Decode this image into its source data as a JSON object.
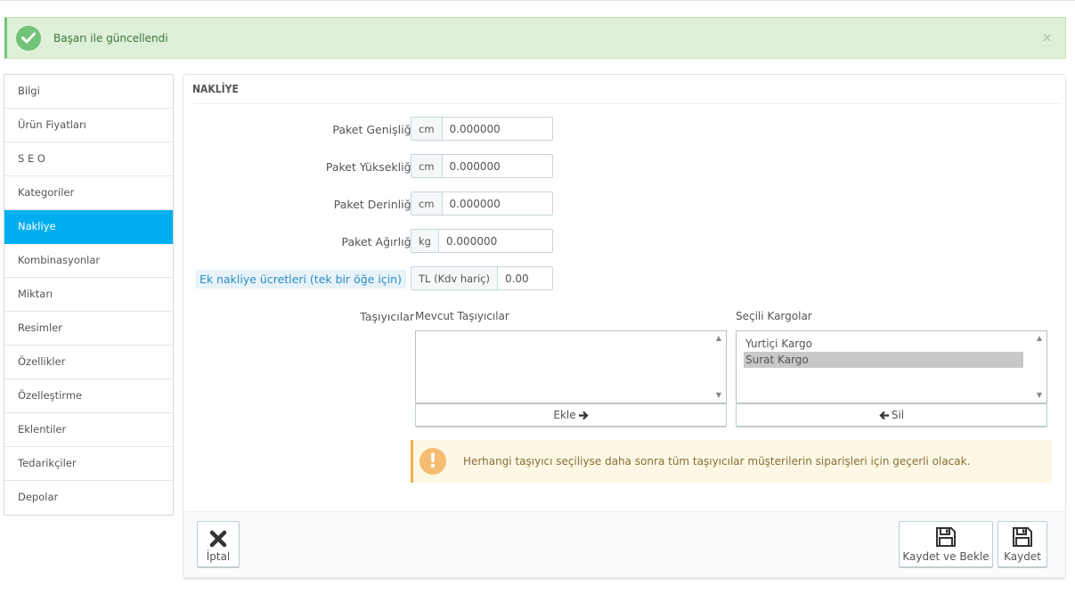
{
  "alert": {
    "message": "Başarı ile güncellendi",
    "close": "×"
  },
  "sidebar": {
    "items": [
      {
        "label": "Bilgi"
      },
      {
        "label": "Ürün Fiyatları"
      },
      {
        "label": "S E O"
      },
      {
        "label": "Kategoriler"
      },
      {
        "label": "Nakliye"
      },
      {
        "label": "Kombinasyonlar"
      },
      {
        "label": "Miktarı"
      },
      {
        "label": "Resimler"
      },
      {
        "label": "Özellikler"
      },
      {
        "label": "Özelleştirme"
      },
      {
        "label": "Eklentiler"
      },
      {
        "label": "Tedarikçiler"
      },
      {
        "label": "Depolar"
      }
    ],
    "active": "Nakliye"
  },
  "panel": {
    "title": "NAKLİYE"
  },
  "form": {
    "width": {
      "label": "Paket Genişliği",
      "unit": "cm",
      "value": "0.000000"
    },
    "height": {
      "label": "Paket Yüksekliği",
      "unit": "cm",
      "value": "0.000000"
    },
    "depth": {
      "label": "Paket Derinliği",
      "unit": "cm",
      "value": "0.000000"
    },
    "weight": {
      "label": "Paket Ağırlığı",
      "unit": "kg",
      "value": "0.000000"
    },
    "extra": {
      "label": "Ek nakliye ücretleri (tek bir öğe için)",
      "unit": "TL (Kdv hariç)",
      "value": "0.00"
    }
  },
  "carriers": {
    "label": "Taşıyıcılar",
    "available_title": "Mevcut Taşıyıcılar",
    "selected_title": "Seçili Kargolar",
    "available": [],
    "selected": [
      "Yurtiçi Kargo",
      "Surat Kargo"
    ],
    "add_label": "Ekle",
    "remove_label": "Sil"
  },
  "warning": {
    "message": "Herhangi taşıyıcı seçiliyse daha sonra tüm taşıyıcılar müşterilerin siparişleri için geçerli olacak."
  },
  "footer": {
    "cancel": "İptal",
    "save_stay": "Kaydet ve Bekle",
    "save": "Kaydet"
  },
  "colors": {
    "accent": "#00aff0",
    "success": "#72c279",
    "warning": "#f5bc72"
  }
}
